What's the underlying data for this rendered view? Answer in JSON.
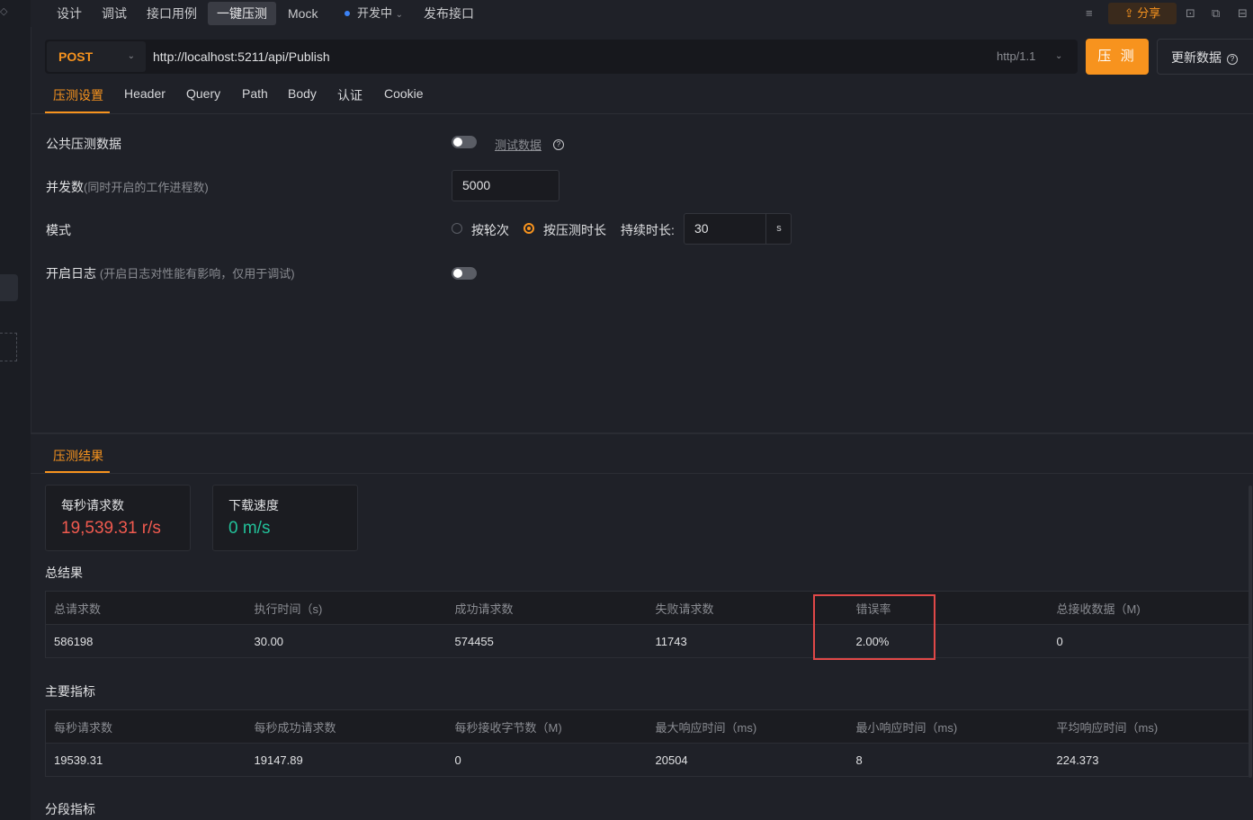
{
  "top_tabs": [
    "设计",
    "调试",
    "接口用例",
    "一键压测",
    "Mock"
  ],
  "status": "开发中",
  "publish": "发布接口",
  "share": "分享",
  "request": {
    "method": "POST",
    "url": "http://localhost:5211/api/Publish",
    "protocol": "http/1.1",
    "run_label": "压 测",
    "update_label": "更新数据"
  },
  "sub_tabs": [
    "压测设置",
    "Header",
    "Query",
    "Path",
    "Body",
    "认证",
    "Cookie"
  ],
  "settings": {
    "public_data_label": "公共压测数据",
    "test_data_link": "测试数据",
    "concurrency_label": "并发数",
    "concurrency_hint": "(同时开启的工作进程数)",
    "concurrency_value": "5000",
    "mode_label": "模式",
    "mode_round": "按轮次",
    "mode_duration": "按压测时长",
    "duration_label": "持续时长:",
    "duration_value": "30",
    "duration_unit": "s",
    "log_label": "开启日志",
    "log_hint": "(开启日志对性能有影响，仅用于调试)"
  },
  "results": {
    "tab": "压测结果",
    "rps_title": "每秒请求数",
    "rps_value": "19,539.31 r/s",
    "download_title": "下载速度",
    "download_value": "0 m/s",
    "summary_title": "总结果",
    "summary_headers": [
      "总请求数",
      "执行时间（s)",
      "成功请求数",
      "失败请求数",
      "错误率",
      "总接收数据（M)"
    ],
    "summary_values": [
      "586198",
      "30.00",
      "574455",
      "11743",
      "2.00%",
      "0"
    ],
    "main_title": "主要指标",
    "main_headers": [
      "每秒请求数",
      "每秒成功请求数",
      "每秒接收字节数（M)",
      "最大响应时间（ms)",
      "最小响应时间（ms)",
      "平均响应时间（ms)"
    ],
    "main_values": [
      "19539.31",
      "19147.89",
      "0",
      "20504",
      "8",
      "224.373"
    ],
    "segment_title": "分段指标"
  },
  "colors": {
    "accent": "#f7931e",
    "error": "#f05a4f",
    "success": "#22c29a",
    "highlight": "#e04848"
  }
}
